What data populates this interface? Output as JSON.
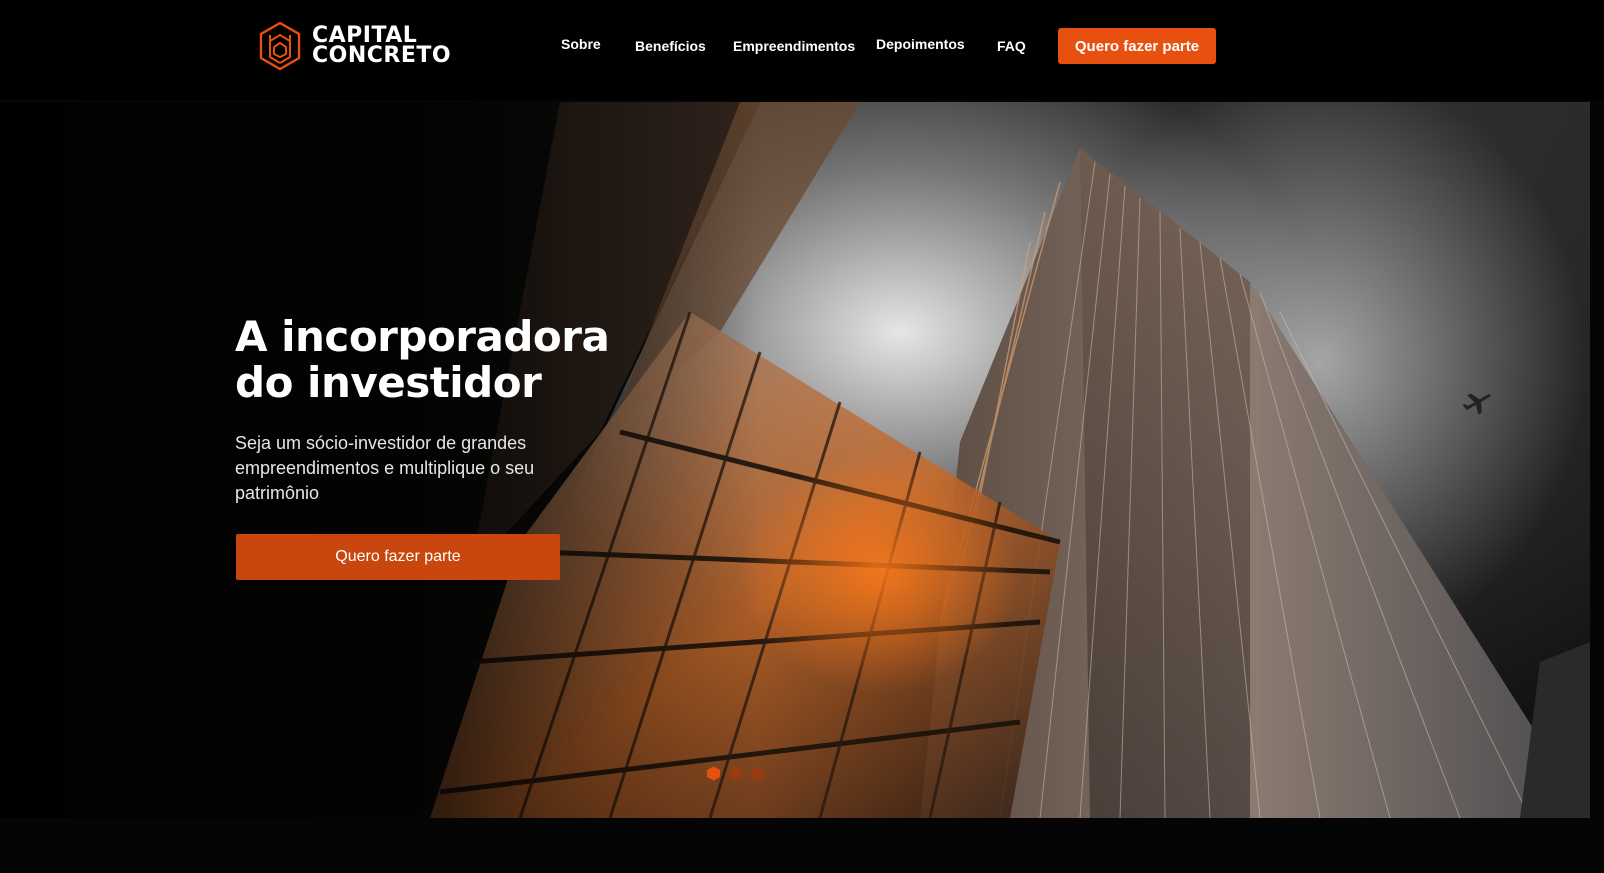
{
  "brand": {
    "line1": "CAPITAL",
    "line2": "CONCRETO",
    "accent_color": "#e8500f"
  },
  "nav": {
    "items": [
      {
        "label": "Sobre"
      },
      {
        "label": "Benefícios"
      },
      {
        "label": "Empreendimentos"
      },
      {
        "label": "Depoimentos"
      },
      {
        "label": "FAQ"
      }
    ],
    "cta_label": "Quero fazer parte"
  },
  "hero": {
    "title_line1": "A incorporadora",
    "title_line2": "do investidor",
    "subtitle": "Seja um sócio-investidor de grandes empreendimentos e multiplique o seu patrimônio",
    "cta_label": "Quero fazer parte",
    "slides": {
      "count": 3,
      "active": 1
    }
  }
}
